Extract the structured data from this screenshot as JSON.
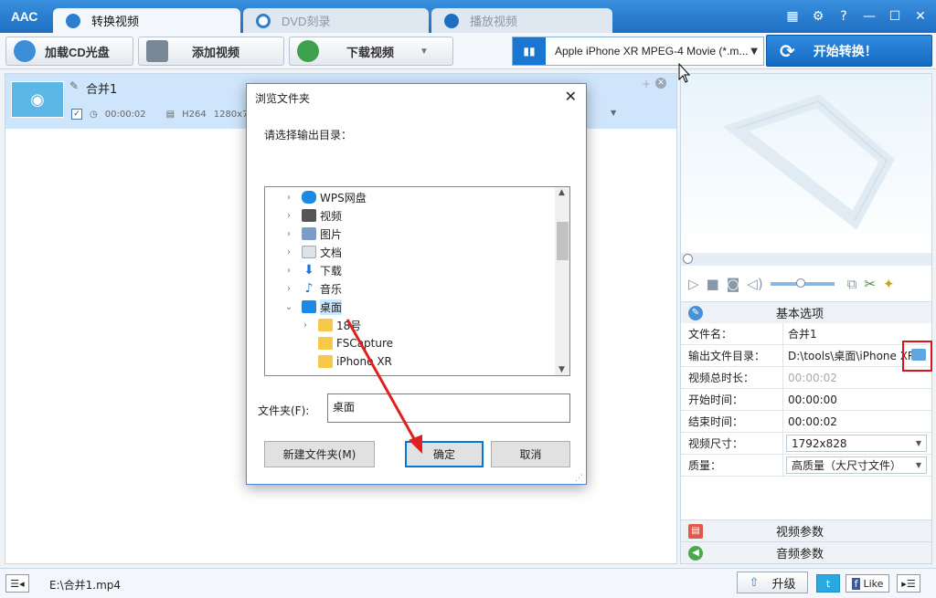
{
  "app": {
    "logo": "AAC"
  },
  "tabs": [
    {
      "label": "转换视频"
    },
    {
      "label": "DVD刻录"
    },
    {
      "label": "播放视频"
    }
  ],
  "window_buttons": [
    "▦",
    "⚙",
    "?",
    "—",
    "☐",
    "✕"
  ],
  "toolbar": {
    "load_cd": "加载CD光盘",
    "add_video": "添加视频",
    "download_video": "下载视频"
  },
  "profile": {
    "label": "Apple iPhone XR MPEG-4 Movie (*.m..."
  },
  "start_button": "开始转换！",
  "file": {
    "name": "合并1",
    "duration": "00:00:02",
    "codec": "H264",
    "resolution": "1280x720"
  },
  "panel": {
    "basic_options": "基本选项",
    "props": [
      {
        "label": "文件名：",
        "value": "合并1"
      },
      {
        "label": "输出文件目录：",
        "value": "D:\\tools\\桌面\\iPhone XR"
      },
      {
        "label": "视频总时长：",
        "value": "00:00:02"
      },
      {
        "label": "开始时间：",
        "value": "00:00:00"
      },
      {
        "label": "结束时间：",
        "value": "00:00:02"
      },
      {
        "label": "视频尺寸：",
        "value": "1792x828"
      },
      {
        "label": "质量：",
        "value": "高质量（大尺寸文件）"
      }
    ],
    "video_params": "视频参数",
    "audio_params": "音频参数"
  },
  "bottom": {
    "path": "E:\\合并1.mp4",
    "upgrade": "升级",
    "like": "Like"
  },
  "dialog": {
    "title": "浏览文件夹",
    "prompt": "请选择输出目录：",
    "tree": [
      {
        "label": "WPS网盘",
        "color": "#1e88e5"
      },
      {
        "label": "视频",
        "color": "#555555"
      },
      {
        "label": "图片",
        "color": "#7a9cc6"
      },
      {
        "label": "文档",
        "color": "#9aa7b5"
      },
      {
        "label": "下载",
        "color": "#1e78d7"
      },
      {
        "label": "音乐",
        "color": "#1e78d7"
      },
      {
        "label": "桌面",
        "color": "#1e88e5"
      },
      {
        "label": "18号",
        "color": "#f6c94a"
      },
      {
        "label": "FSCapture",
        "color": "#f6c94a"
      },
      {
        "label": "iPhone XR",
        "color": "#f6c94a"
      }
    ],
    "folder_label": "文件夹(F):",
    "folder_value": "桌面",
    "new_folder": "新建文件夹(M)",
    "ok": "确定",
    "cancel": "取消"
  }
}
